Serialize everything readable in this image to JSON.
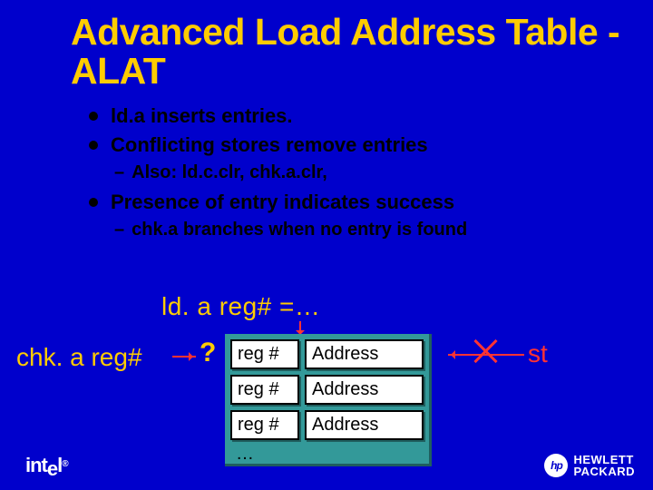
{
  "title": "Advanced Load Address Table - ALAT",
  "bullets": [
    {
      "text": "ld.a inserts entries.",
      "sub": []
    },
    {
      "text": "Conflicting stores remove entries",
      "sub": [
        "Also: ld.c.clr, chk.a.clr,"
      ]
    },
    {
      "text": "Presence of entry indicates success",
      "sub": [
        "chk.a branches when no entry is found"
      ]
    }
  ],
  "diagram": {
    "lda_label": "ld. a reg# =…",
    "chka_label": "chk. a reg#",
    "question_mark": "?",
    "st_label": "st",
    "rows": [
      {
        "reg": "reg #",
        "addr": "Address"
      },
      {
        "reg": "reg #",
        "addr": "Address"
      },
      {
        "reg": "reg #",
        "addr": "Address"
      }
    ],
    "ellipsis": "…"
  },
  "logos": {
    "intel": "intel.",
    "hp_mark": "hp",
    "hp_line1": "HEWLETT",
    "hp_line2": "PACKARD"
  }
}
